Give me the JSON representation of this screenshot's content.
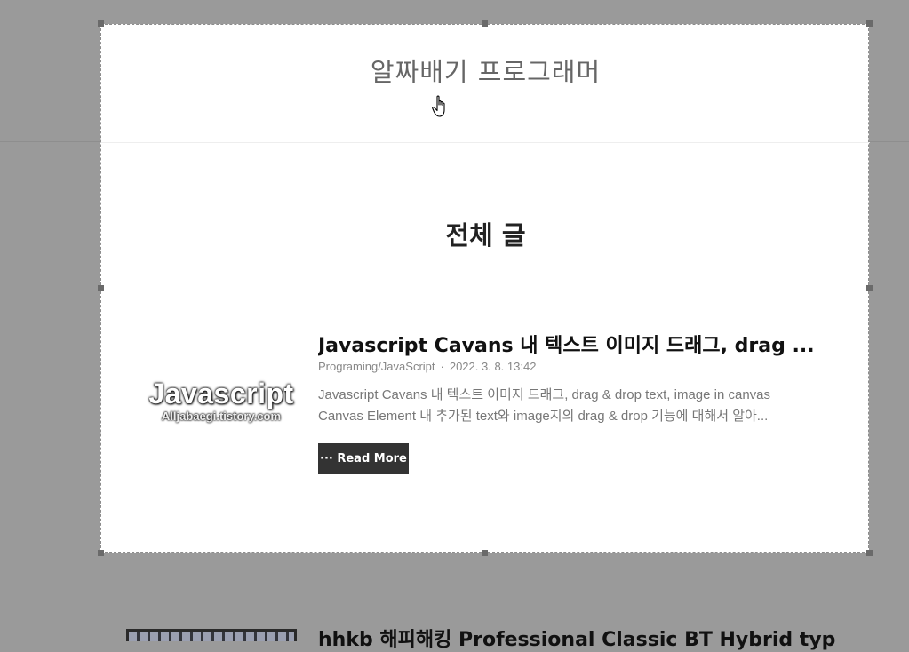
{
  "blog": {
    "title": "알짜배기 프로그래머"
  },
  "section": {
    "title": "전체 글"
  },
  "posts": [
    {
      "title": "Javascript Cavans 내 텍스트 이미지 드래그, drag ...",
      "category": "Programing/JavaScript",
      "separator": "·",
      "date": "2022. 3. 8. 13:42",
      "excerpt_line1": "Javascript Cavans 내 텍스트 이미지 드래그, drag & drop text, image in canvas",
      "excerpt_line2": "Canvas Element 내 추가된 text와 image지의 drag & drop 기능에 대해서 알아...",
      "thumbnail_main": "Javascript",
      "thumbnail_sub": "Alljabaegi.tistory.com",
      "read_more": "··· Read More"
    },
    {
      "title": "hhkb 해피해킹 Professional Classic BT Hybrid typ"
    }
  ],
  "colors": {
    "overlay": "#9a9a9a",
    "panel": "#ffffff",
    "button": "#333333"
  },
  "icons": {
    "cursor": "hand-pointer-icon"
  }
}
